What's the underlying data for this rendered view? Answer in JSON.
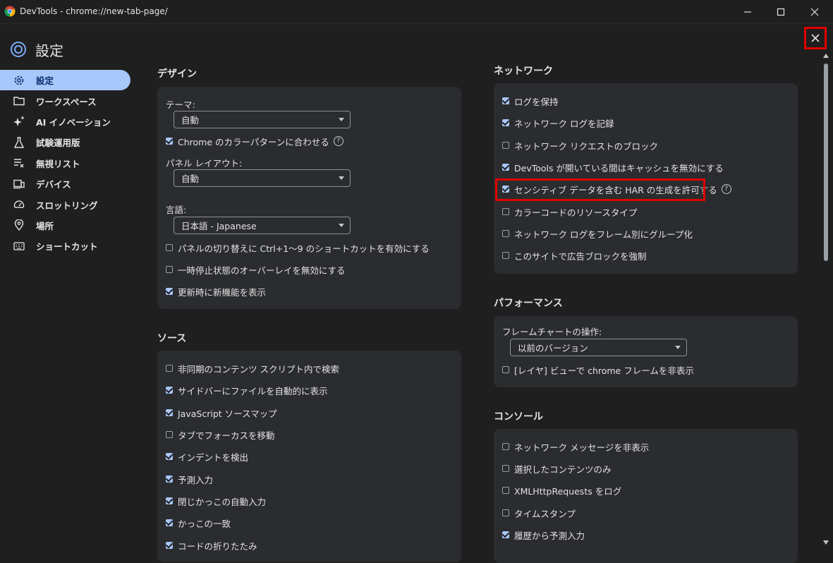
{
  "window": {
    "title": "DevTools - chrome://new-tab-page/",
    "minimize_icon": "minimize-icon",
    "maximize_icon": "maximize-icon",
    "close_icon": "close-icon"
  },
  "header": {
    "title": "設定"
  },
  "sidebar": {
    "items": [
      {
        "label": "設定",
        "icon": "gear-icon",
        "active": true
      },
      {
        "label": "ワークスペース",
        "icon": "folder-icon",
        "active": false
      },
      {
        "label": "AI イノベーション",
        "icon": "sparkle-icon",
        "active": false
      },
      {
        "label": "試験運用版",
        "icon": "flask-icon",
        "active": false
      },
      {
        "label": "無視リスト",
        "icon": "ignore-list-icon",
        "active": false
      },
      {
        "label": "デバイス",
        "icon": "devices-icon",
        "active": false
      },
      {
        "label": "スロットリング",
        "icon": "speedometer-icon",
        "active": false
      },
      {
        "label": "場所",
        "icon": "location-pin-icon",
        "active": false
      },
      {
        "label": "ショートカット",
        "icon": "keyboard-icon",
        "active": false
      }
    ]
  },
  "design": {
    "title": "デザイン",
    "theme_label": "テーマ:",
    "theme_value": "自動",
    "match_color": {
      "label": "Chrome のカラーパターンに合わせる",
      "checked": true
    },
    "panel_layout_label": "パネル レイアウト:",
    "panel_layout_value": "自動",
    "language_label": "言語:",
    "language_value": "日本語 - Japanese",
    "checkboxes": [
      {
        "label": "パネルの切り替えに Ctrl+1〜9 のショートカットを有効にする",
        "checked": false
      },
      {
        "label": "一時停止状態のオーバーレイを無効にする",
        "checked": false
      },
      {
        "label": "更新時に新機能を表示",
        "checked": true
      }
    ]
  },
  "sources": {
    "title": "ソース",
    "checkboxes": [
      {
        "label": "非同期のコンテンツ スクリプト内で検索",
        "checked": false
      },
      {
        "label": "サイドバーにファイルを自動的に表示",
        "checked": true
      },
      {
        "label": "JavaScript ソースマップ",
        "checked": true
      },
      {
        "label": "タブでフォーカスを移動",
        "checked": false
      },
      {
        "label": "インデントを検出",
        "checked": true
      },
      {
        "label": "予測入力",
        "checked": true
      },
      {
        "label": "閉じかっこの自動入力",
        "checked": true
      },
      {
        "label": "かっこの一致",
        "checked": true
      },
      {
        "label": "コードの折りたたみ",
        "checked": true
      }
    ]
  },
  "network": {
    "title": "ネットワーク",
    "checkboxes": [
      {
        "label": "ログを保持",
        "checked": true
      },
      {
        "label": "ネットワーク ログを記録",
        "checked": true
      },
      {
        "label": "ネットワーク リクエストのブロック",
        "checked": false
      },
      {
        "label": "DevTools が開いている間はキャッシュを無効にする",
        "checked": true
      },
      {
        "label": "センシティブ データを含む HAR の生成を許可する",
        "checked": true
      },
      {
        "label": "カラーコードのリソースタイプ",
        "checked": false
      },
      {
        "label": "ネットワーク ログをフレーム別にグループ化",
        "checked": false
      },
      {
        "label": "このサイトで広告ブロックを強制",
        "checked": false
      }
    ]
  },
  "performance": {
    "title": "パフォーマンス",
    "flamechart_label": "フレームチャートの操作:",
    "flamechart_value": "以前のバージョン",
    "checkboxes": [
      {
        "label": "[レイヤ] ビューで chrome フレームを非表示",
        "checked": false
      }
    ]
  },
  "console": {
    "title": "コンソール",
    "checkboxes": [
      {
        "label": "ネットワーク メッセージを非表示",
        "checked": false
      },
      {
        "label": "選択したコンテンツのみ",
        "checked": false
      },
      {
        "label": "XMLHttpRequests をログ",
        "checked": false
      },
      {
        "label": "タイムスタンプ",
        "checked": false
      },
      {
        "label": "履歴から予測入力",
        "checked": true
      }
    ]
  },
  "help_icon": "help-circle-icon",
  "colors": {
    "accent": "#a8c7fa",
    "highlight": "#e00000",
    "card": "#2b2c2f",
    "background": "#1f1f1f"
  }
}
